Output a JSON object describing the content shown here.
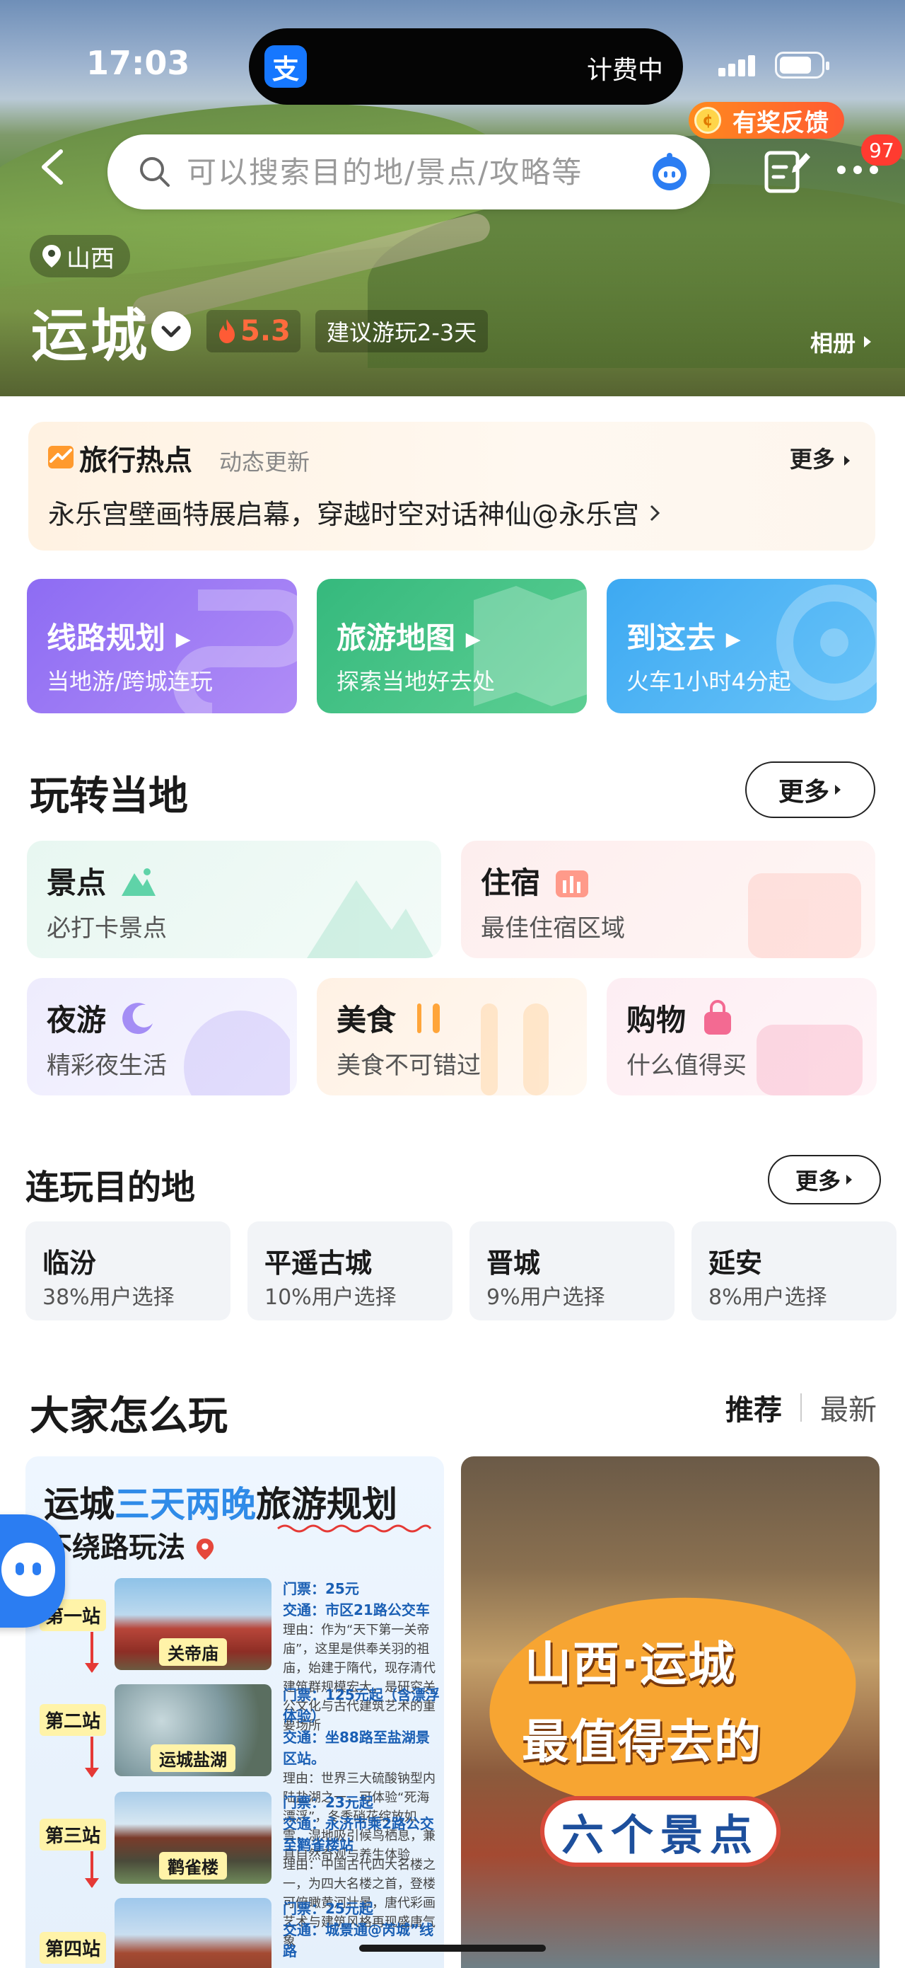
{
  "status_bar": {
    "time": "17:03",
    "app_badge": "支",
    "billing": "计费中"
  },
  "nav": {
    "search_placeholder": "可以搜索目的地/景点/攻略等",
    "feedback_label": "有奖反馈",
    "message_count": "97"
  },
  "hero": {
    "province": "山西",
    "city": "运城",
    "heat": "5.3",
    "suggest": "建议游玩2-3天",
    "album": "相册"
  },
  "hot_news": {
    "title": "旅行热点",
    "subtitle": "动态更新",
    "more": "更多",
    "headline": "永乐宫壁画特展启幕，穿越时空对话神仙@永乐宫"
  },
  "features": [
    {
      "title": "线路规划",
      "subtitle": "当地游/跨城连玩"
    },
    {
      "title": "旅游地图",
      "subtitle": "探索当地好去处"
    },
    {
      "title": "到这去",
      "subtitle": "火车1小时4分起"
    }
  ],
  "local": {
    "title": "玩转当地",
    "more": "更多",
    "cards": [
      {
        "title": "景点",
        "subtitle": "必打卡景点"
      },
      {
        "title": "住宿",
        "subtitle": "最佳住宿区域"
      },
      {
        "title": "夜游",
        "subtitle": "精彩夜生活"
      },
      {
        "title": "美食",
        "subtitle": "美食不可错过"
      },
      {
        "title": "购物",
        "subtitle": "什么值得买"
      }
    ]
  },
  "destinations": {
    "title": "连玩目的地",
    "more": "更多",
    "items": [
      {
        "name": "临汾",
        "share": "38%用户选择"
      },
      {
        "name": "平遥古城",
        "share": "10%用户选择"
      },
      {
        "name": "晋城",
        "share": "9%用户选择"
      },
      {
        "name": "延安",
        "share": "8%用户选择"
      }
    ]
  },
  "posts": {
    "title": "大家怎么玩",
    "tab_recommend": "推荐",
    "tab_latest": "最新",
    "left": {
      "title_a": "运城",
      "title_b": "三天两晚",
      "title_c": "旅游规划",
      "subtitle": "不绕路玩法",
      "stations": [
        {
          "station": "第一站",
          "spot": "关帝庙",
          "ticket": "门票：25元",
          "transport": "交通：市区21路公交车",
          "desc": "理由：作为“天下第一关帝庙”，这里是供奉关羽的祖庙，始建于隋代，现存清代建筑群规模宏大，是研究关公文化与古代建筑艺术的重要场所"
        },
        {
          "station": "第二站",
          "spot": "运城盐湖",
          "ticket": "门票：125元起（含漂浮体验）",
          "transport": "交通：坐88路至盐湖景区站。",
          "desc": "理由：世界三大硫酸钠型内陆盐湖之一，可体验“死海漂浮”，冬季硝花绽放如雪，湿地吸引候鸟栖息，兼具自然奇观与养生体验"
        },
        {
          "station": "第三站",
          "spot": "鹳雀楼",
          "ticket": "门票：23元起",
          "transport": "交通：永济市乘2路公交至鹳雀楼站",
          "desc": "理由：中国古代四大名楼之一，为四大名楼之首，登楼可俯瞰黄河壮景，唐代彩画艺术与建筑风格再现盛唐气象"
        },
        {
          "station": "第四站",
          "spot": "",
          "ticket": "门票：25元起",
          "transport": "交通：城景通@芮城”线路",
          "desc": ""
        }
      ]
    },
    "right": {
      "line1": "山西·运城",
      "line2": "最值得去的",
      "line3": "六个景点"
    }
  }
}
